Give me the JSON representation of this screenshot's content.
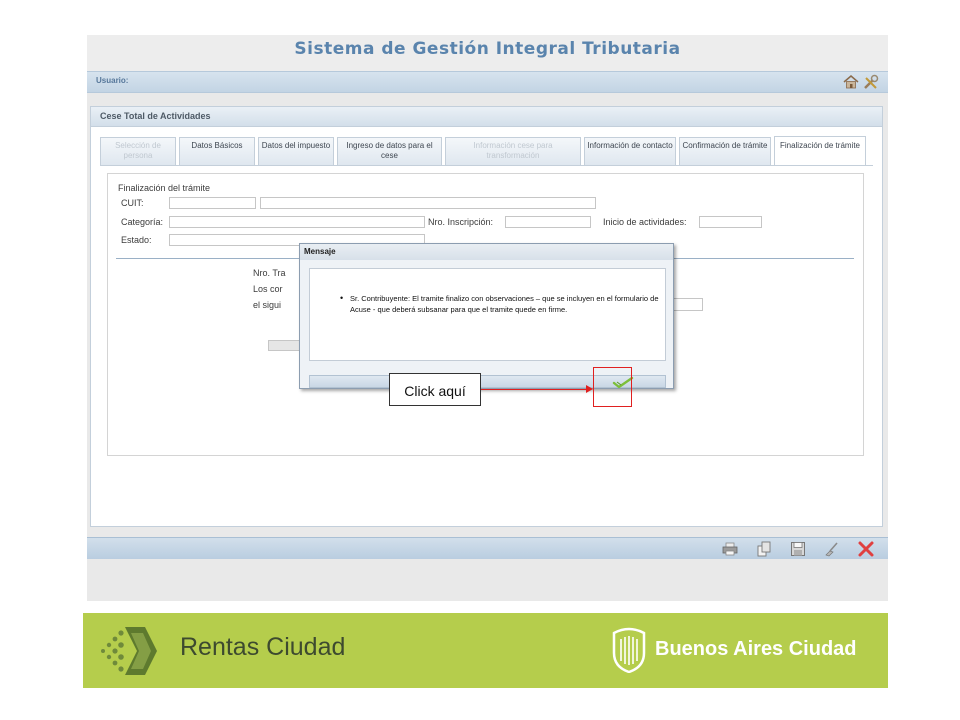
{
  "app": {
    "title": "Sistema de Gestión Integral Tributaria",
    "user_label": "Usuario:"
  },
  "panel": {
    "title": "Cese Total de Actividades",
    "tabs": [
      {
        "label": "Selección de persona",
        "state": "disabled"
      },
      {
        "label": "Datos Básicos",
        "state": "enabled"
      },
      {
        "label": "Datos del impuesto",
        "state": "enabled"
      },
      {
        "label": "Ingreso de datos para el cese",
        "state": "enabled"
      },
      {
        "label": "Información cese para transformación",
        "state": "disabled"
      },
      {
        "label": "Información de contacto",
        "state": "enabled"
      },
      {
        "label": "Confirmación de trámite",
        "state": "enabled"
      },
      {
        "label": "Finalización de trámite",
        "state": "active"
      }
    ]
  },
  "form": {
    "section_title": "Finalización del trámite",
    "cuit_label": "CUIT:",
    "categoria_label": "Categoría:",
    "nro_inscripcion_label": "Nro. Inscripción:",
    "inicio_actividades_label": "Inicio de actividades:",
    "estado_label": "Estado:",
    "partial_line1": "Nro. Tra",
    "partial_line2": "Los cor",
    "partial_line3": "el sigui"
  },
  "modal": {
    "title": "Mensaje",
    "message": "Sr. Contribuyente: El tramite finalizo con observaciones – que se incluyen en el formulario de Acuse - que deberá subsanar para que el tramite quede en firme."
  },
  "callout": {
    "text": "Click aquí"
  },
  "banner": {
    "left_brand": "Rentas Ciudad",
    "right_brand": "Buenos Aires Ciudad"
  },
  "colors": {
    "accent_red": "#e02020",
    "banner_green": "#b5cd4c",
    "title_blue": "#5a84ad"
  }
}
